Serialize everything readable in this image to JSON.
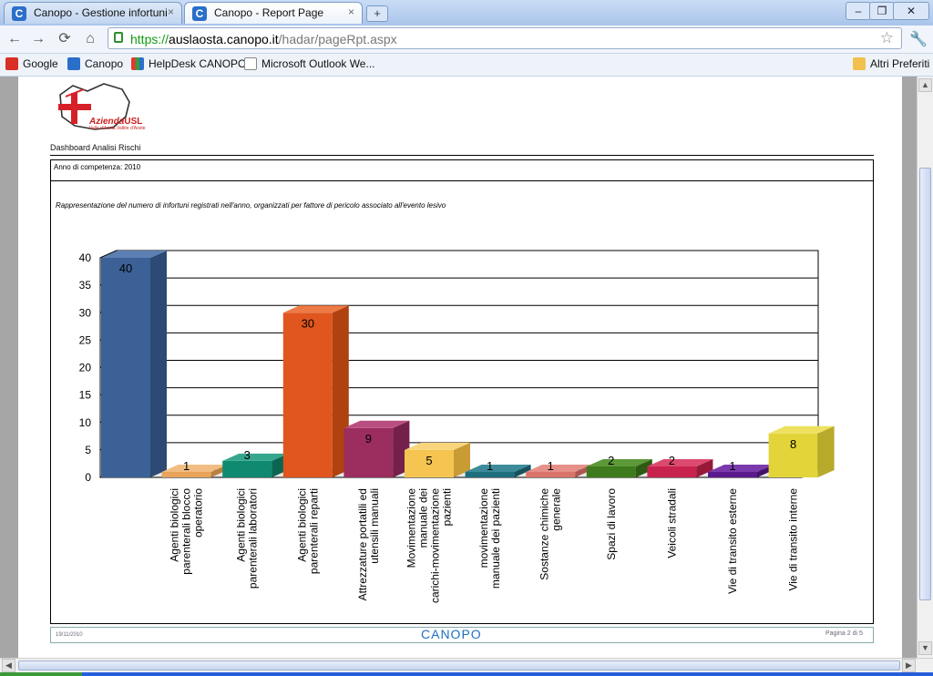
{
  "browser": {
    "tabs": [
      {
        "label": "Canopo - Gestione infortuni",
        "close": "×"
      },
      {
        "label": "Canopo - Report Page",
        "close": "×"
      }
    ],
    "new_tab": "+",
    "window_controls": [
      "–",
      "❐",
      "✕"
    ],
    "nav": {
      "back": "←",
      "forward": "→",
      "reload": "⟳",
      "home": "⌂"
    },
    "address": {
      "scheme": "https://",
      "host": "auslaosta.canopo.it",
      "path": "/hadar/pageRpt.aspx"
    },
    "bookmarks": [
      {
        "label": "Google",
        "icon": "google-icon",
        "color": "#d93025"
      },
      {
        "label": "Canopo",
        "icon": "canopo-icon",
        "color": "#2a6fc9"
      },
      {
        "label": "HelpDesk CANOPO",
        "icon": "helpdesk-icon",
        "color": "#3a9a3a"
      },
      {
        "label": "Microsoft Outlook We...",
        "icon": "page-icon",
        "color": "#ffffff"
      }
    ],
    "other_bookmarks": "Altri Preferiti"
  },
  "report": {
    "logo": {
      "text": "Azienda",
      "bold": "USL",
      "sub": "Valle d'Aosta Vallée d'Aoste"
    },
    "dashboard_title": "Dashboard Analisi Rischi",
    "year_label": "Anno di competenza: 2010",
    "description": "Rappresentazione del numero di infortuni registrati nell'anno, organizzati per fattore di pericolo associato all'evento lesivo",
    "footer": {
      "date": "19/11/2010",
      "brand": "CANOPO",
      "page": "Pagina 2 di 5"
    }
  },
  "chart_data": {
    "type": "bar",
    "categories": [
      "Agenti biologici parenterali blocco operatorio",
      "Agenti biologici parenterali laboratori",
      "Agenti biologici parenterali reparti",
      "Attrezzature portatili ed utensili manuali",
      "Movimentazione manuale dei carichi-movimentazione pazienti",
      "movimentazione manuale dei pazienti",
      "Sostanze chimiche generale",
      "Spazi di lavoro",
      "Veicoli stradali",
      "Vie di transito esterne",
      "Vie di transito interne"
    ],
    "category_lines": [
      [
        "Agenti biologici",
        "parenterali blocco",
        "operatorio"
      ],
      [
        "Agenti biologici",
        "parenterali laboratori"
      ],
      [
        "Agenti biologici",
        "parenterali reparti"
      ],
      [
        "Attrezzature portatili ed",
        "utensili manuali"
      ],
      [
        "Movimentazione",
        "manuale dei",
        "carichi-movimentazione",
        "pazienti"
      ],
      [
        "movimentazione",
        "manuale dei pazienti"
      ],
      [
        "Sostanze chimiche",
        "generale"
      ],
      [
        "Spazi di lavoro"
      ],
      [
        "Veicoli stradali"
      ],
      [
        "Vie di transito esterne"
      ],
      [
        "Vie di transito interne"
      ]
    ],
    "values": [
      40,
      1,
      3,
      30,
      9,
      5,
      1,
      1,
      2,
      2,
      1,
      8
    ],
    "ylim": [
      0,
      40
    ],
    "yticks": [
      0,
      5,
      10,
      15,
      20,
      25,
      30,
      35,
      40
    ],
    "grid": true,
    "colors": [
      "#3b6196",
      "#e8a35a",
      "#0f8a70",
      "#e0561e",
      "#9b2d5f",
      "#f5c451",
      "#1f6e7e",
      "#d9746a",
      "#3e7a1e",
      "#c8234f",
      "#5b1a8c",
      "#e3d43a"
    ],
    "side_colors": [
      "#2c4a74",
      "#b9813f",
      "#0a6653",
      "#b0420f",
      "#74204a",
      "#c99b35",
      "#15525e",
      "#ab5750",
      "#2c5b13",
      "#971939",
      "#43116a",
      "#b7a92a"
    ],
    "top_colors": [
      "#5c80b3",
      "#f2bd83",
      "#34a78d",
      "#ee7a45",
      "#b94f80",
      "#f8d57c",
      "#3d8b9a",
      "#e59088",
      "#5d9839",
      "#dd4a6f",
      "#7a3aac",
      "#eee160"
    ]
  }
}
